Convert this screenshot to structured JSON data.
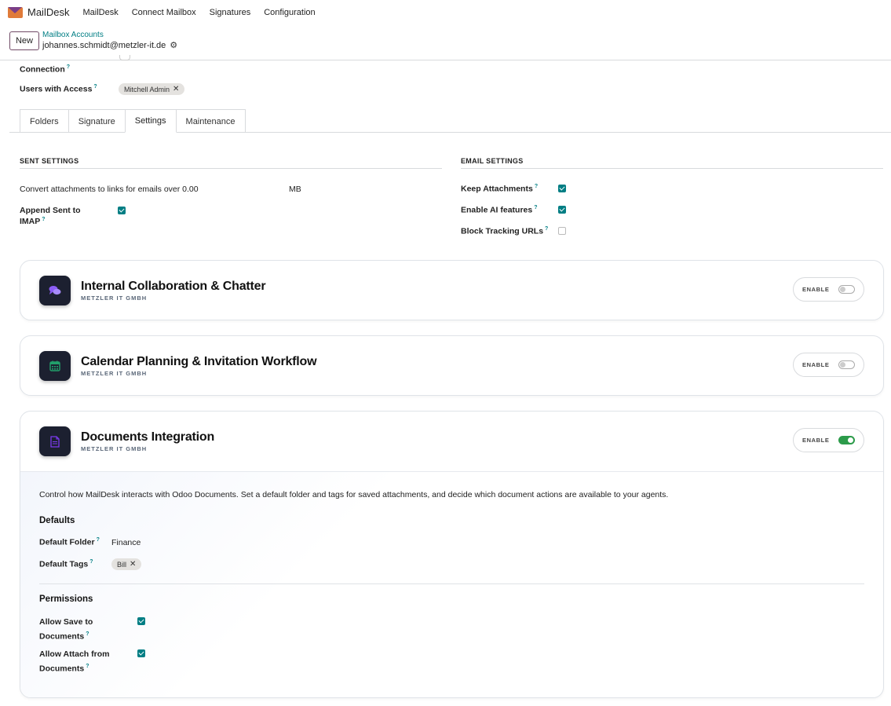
{
  "navbar": {
    "brand": "MailDesk",
    "items": [
      "MailDesk",
      "Connect Mailbox",
      "Signatures",
      "Configuration"
    ]
  },
  "control": {
    "new_label": "New",
    "breadcrumb": "Mailbox Accounts",
    "record_name": "johannes.schmidt@metzler-it.de"
  },
  "form": {
    "connection_label": "Connection",
    "users_label": "Users with Access",
    "users_tag": "Mitchell Admin"
  },
  "tabs": [
    "Folders",
    "Signature",
    "Settings",
    "Maintenance"
  ],
  "active_tab": "Settings",
  "sent_settings": {
    "title": "SENT SETTINGS",
    "convert_label": "Convert attachments to links for emails over 0.00",
    "convert_unit": "MB",
    "append_label_1": "Append Sent to",
    "append_label_2": "IMAP",
    "append_checked": true
  },
  "email_settings": {
    "title": "EMAIL SETTINGS",
    "keep_label": "Keep Attachments",
    "keep_checked": true,
    "ai_label": "Enable AI features",
    "ai_checked": true,
    "block_label": "Block Tracking URLs",
    "block_checked": false
  },
  "cards": [
    {
      "title": "Internal Collaboration & Chatter",
      "subtitle": "METZLER IT GMBH",
      "enable_label": "ENABLE",
      "enabled": false,
      "icon": "chat-bubbles-icon",
      "icon_color": "#8b5cf6"
    },
    {
      "title": "Calendar Planning & Invitation Workflow",
      "subtitle": "METZLER IT GMBH",
      "enable_label": "ENABLE",
      "enabled": false,
      "icon": "calendar-icon",
      "icon_color": "#22a06b"
    },
    {
      "title": "Documents Integration",
      "subtitle": "METZLER IT GMBH",
      "enable_label": "ENABLE",
      "enabled": true,
      "icon": "document-icon",
      "icon_color": "#7c3aed"
    }
  ],
  "documents": {
    "description": "Control how MailDesk interacts with Odoo Documents. Set a default folder and tags for saved attachments, and decide which document actions are available to your agents.",
    "defaults_heading": "Defaults",
    "default_folder_label": "Default Folder",
    "default_folder_value": "Finance",
    "default_tags_label": "Default Tags",
    "default_tag": "Bill",
    "permissions_heading": "Permissions",
    "allow_save_1": "Allow Save to",
    "allow_save_2": "Documents",
    "allow_save_checked": true,
    "allow_attach_1": "Allow Attach from",
    "allow_attach_2": "Documents",
    "allow_attach_checked": true
  },
  "colors": {
    "accent": "#017e84",
    "brand": "#714b67",
    "toggle_on": "#2c9b4a"
  }
}
